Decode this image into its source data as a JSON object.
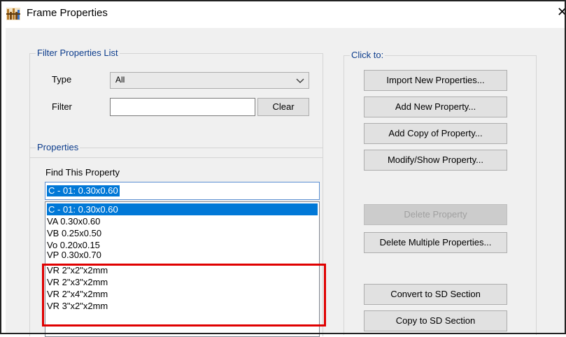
{
  "window": {
    "title": "Frame Properties",
    "close_glyph": "✕"
  },
  "filter_group": {
    "legend": "Filter Properties List",
    "type_label": "Type",
    "type_value": "All",
    "filter_label": "Filter",
    "filter_value": "",
    "clear_label": "Clear"
  },
  "properties_group": {
    "legend": "Properties",
    "find_label": "Find This Property",
    "find_value": "C - 01: 0.30x0.60",
    "items": [
      "C - 01: 0.30x0.60",
      "VA 0.30x0.60",
      "VB 0.25x0.50",
      "Vo 0.20x0.15",
      "VP 0.30x0.70",
      "VR 2\"x2\"x2mm",
      "VR 2\"x3\"x2mm",
      "VR 2\"x4\"x2mm",
      "VR 3\"x2\"x2mm"
    ],
    "selected_index": 0
  },
  "actions_group": {
    "legend": "Click to:",
    "import_label": "Import New Properties...",
    "add_new_label": "Add New Property...",
    "add_copy_label": "Add Copy of Property...",
    "modify_label": "Modify/Show Property...",
    "delete_label": "Delete Property",
    "delete_multiple_label": "Delete Multiple Properties...",
    "convert_sd_label": "Convert to SD Section",
    "copy_sd_label": "Copy to SD Section"
  },
  "colors": {
    "selection": "#0078d7",
    "highlight_box": "#e00000",
    "legend_text": "#0c3c8c"
  }
}
